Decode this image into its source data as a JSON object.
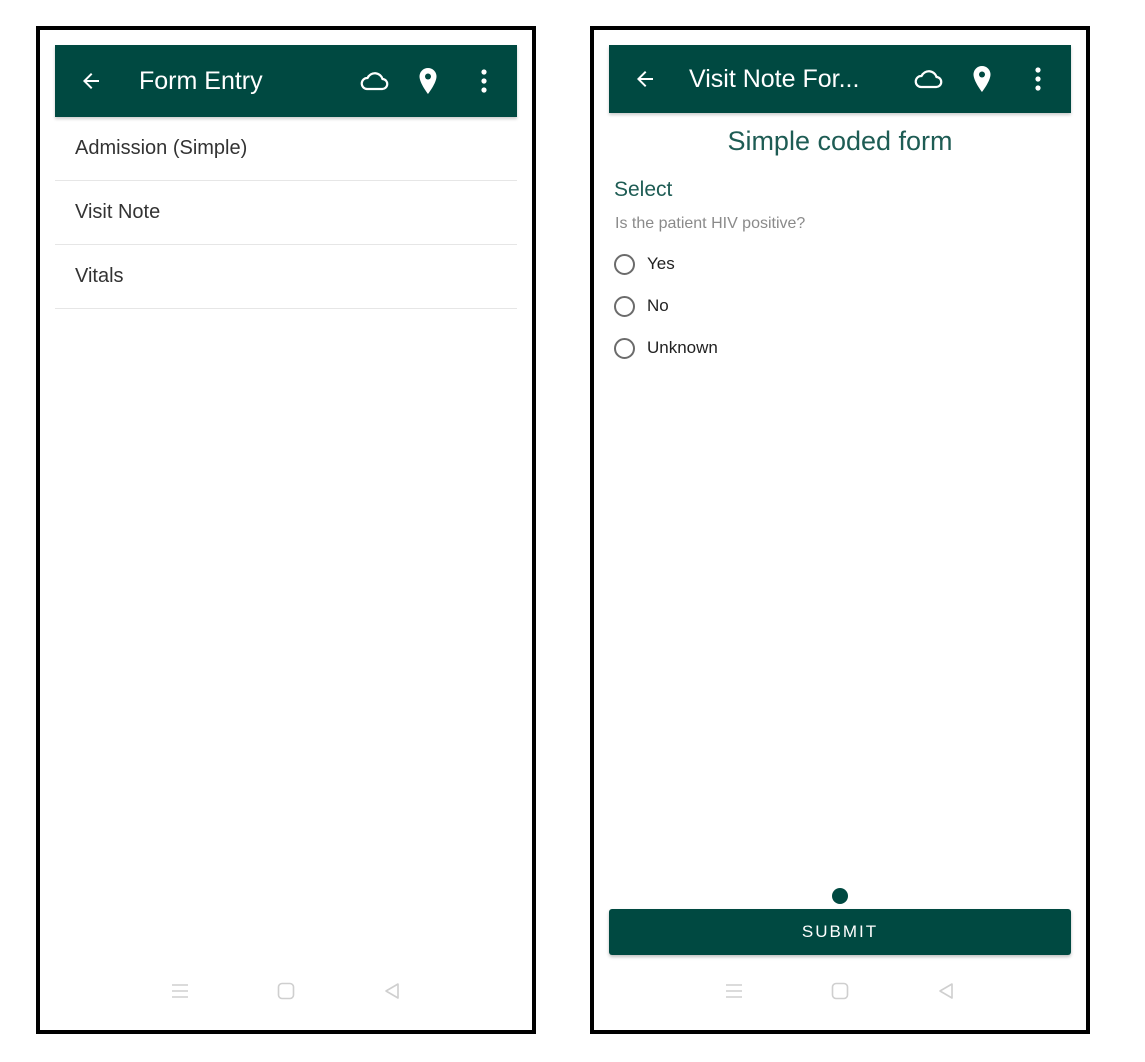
{
  "theme": {
    "primary": "#004941",
    "accent_text": "#1e5c54"
  },
  "left_screen": {
    "appbar": {
      "title": "Form Entry",
      "icons": [
        "back-arrow-icon",
        "cloud-icon",
        "location-pin-icon",
        "more-vert-icon"
      ]
    },
    "forms": [
      {
        "label": "Admission (Simple)"
      },
      {
        "label": "Visit Note"
      },
      {
        "label": "Vitals"
      }
    ],
    "navbar": [
      "menu-icon",
      "home-icon",
      "back-icon"
    ]
  },
  "right_screen": {
    "appbar": {
      "title": "Visit Note For...",
      "icons": [
        "back-arrow-icon",
        "cloud-icon",
        "location-pin-icon",
        "more-vert-icon"
      ]
    },
    "form_title": "Simple coded form",
    "section": "Select",
    "question": "Is the patient HIV positive?",
    "options": [
      {
        "label": "Yes",
        "selected": false
      },
      {
        "label": "No",
        "selected": false
      },
      {
        "label": "Unknown",
        "selected": false
      }
    ],
    "page_indicator": {
      "current": 1,
      "total": 1
    },
    "submit_label": "SUBMIT",
    "navbar": [
      "menu-icon",
      "home-icon",
      "back-icon"
    ]
  }
}
